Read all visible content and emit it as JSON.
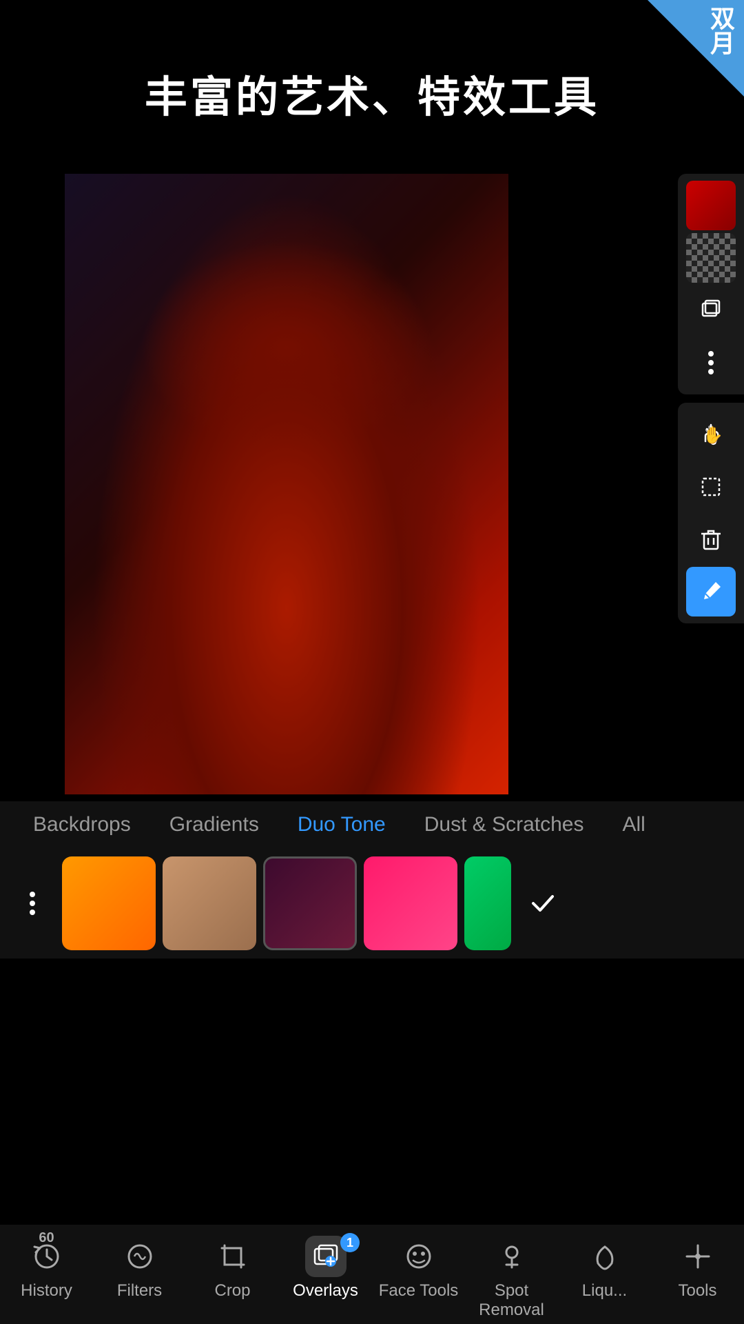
{
  "app": {
    "title": "丰富的艺术、特效工具",
    "banner_text": "双月"
  },
  "toolbar": {
    "buttons": [
      {
        "name": "color-swatch",
        "type": "color"
      },
      {
        "name": "checker-pattern",
        "type": "checker"
      },
      {
        "name": "layers",
        "type": "icon"
      },
      {
        "name": "more-options",
        "type": "dots"
      }
    ],
    "bottom_buttons": [
      {
        "name": "hand-tool",
        "type": "hand"
      },
      {
        "name": "selection-tool",
        "type": "selection"
      },
      {
        "name": "delete-tool",
        "type": "delete"
      }
    ],
    "blue_button": {
      "name": "eyedropper",
      "type": "eyedropper"
    }
  },
  "overlay_tabs": {
    "items": [
      {
        "label": "Backdrops",
        "active": false
      },
      {
        "label": "Gradients",
        "active": false
      },
      {
        "label": "Duo Tone",
        "active": true
      },
      {
        "label": "Dust & Scratches",
        "active": false
      },
      {
        "label": "All",
        "active": false
      }
    ]
  },
  "swatches": [
    {
      "type": "menu",
      "label": "options"
    },
    {
      "type": "color",
      "color_class": "orange"
    },
    {
      "type": "color",
      "color_class": "tan"
    },
    {
      "type": "color",
      "color_class": "dark-red"
    },
    {
      "type": "color",
      "color_class": "hot-pink"
    },
    {
      "type": "color",
      "color_class": "green-partial"
    },
    {
      "type": "check"
    }
  ],
  "bottom_nav": {
    "items": [
      {
        "label": "History",
        "icon": "history",
        "active": false,
        "badge": "60"
      },
      {
        "label": "Filters",
        "icon": "filters",
        "active": false
      },
      {
        "label": "Crop",
        "icon": "crop",
        "active": false
      },
      {
        "label": "Overlays",
        "icon": "overlays",
        "active": true,
        "badge": "1"
      },
      {
        "label": "Face Tools",
        "icon": "face",
        "active": false
      },
      {
        "label": "Spot Removal",
        "icon": "spot",
        "active": false
      },
      {
        "label": "Liqu...",
        "icon": "liquify",
        "active": false
      },
      {
        "label": "Tools",
        "icon": "tools",
        "active": false
      }
    ]
  }
}
